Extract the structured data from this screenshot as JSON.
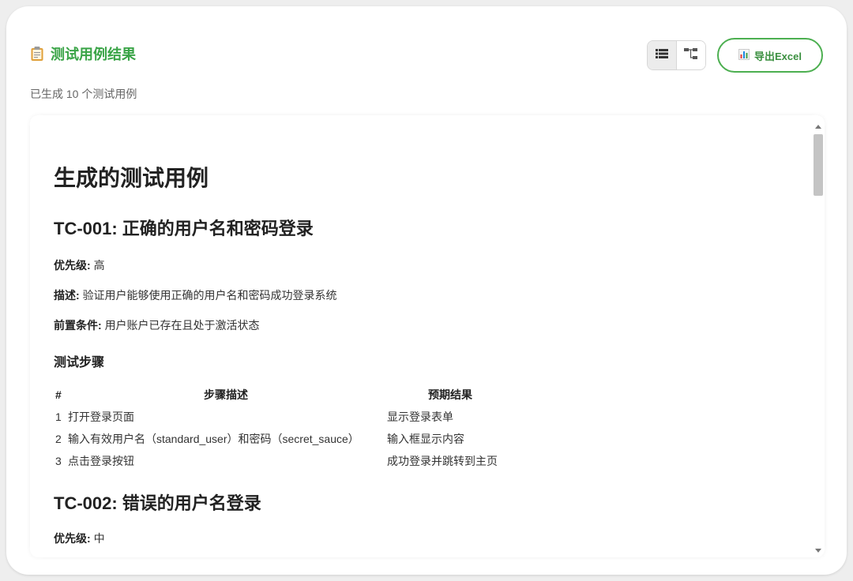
{
  "header": {
    "title": "测试用例结果",
    "export_label": "导出Excel"
  },
  "summary": "已生成 10 个测试用例",
  "doc": {
    "heading": "生成的测试用例",
    "tc1": {
      "title": "TC-001: 正确的用户名和密码登录",
      "priority_label": "优先级:",
      "priority_value": "高",
      "desc_label": "描述:",
      "desc_value": "验证用户能够使用正确的用户名和密码成功登录系统",
      "pre_label": "前置条件:",
      "pre_value": "用户账户已存在且处于激活状态",
      "steps_heading": "测试步骤",
      "table_headers": [
        "#",
        "步骤描述",
        "预期结果"
      ],
      "rows": [
        {
          "num": "1",
          "step": "打开登录页面",
          "result": "显示登录表单"
        },
        {
          "num": "2",
          "step": "输入有效用户名（standard_user）和密码（secret_sauce）",
          "result": "输入框显示内容"
        },
        {
          "num": "3",
          "step": "点击登录按钮",
          "result": "成功登录并跳转到主页"
        }
      ]
    },
    "tc2": {
      "title": "TC-002: 错误的用户名登录",
      "priority_label": "优先级:",
      "priority_value": "中"
    }
  },
  "icons": {
    "title_icon": "clipboard-icon",
    "list_view": "list-view-icon",
    "tree_view": "tree-view-icon",
    "export_icon": "bar-chart-icon"
  },
  "colors": {
    "accent": "#3aa447",
    "export_border": "#4caf50"
  }
}
